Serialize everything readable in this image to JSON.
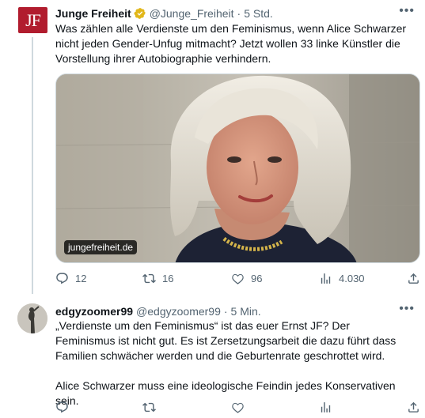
{
  "tweets": [
    {
      "display_name": "Junge Freiheit",
      "avatar_text": "JF",
      "handle": "@Junge_Freiheit",
      "separator": "·",
      "time": "5 Std.",
      "text": [
        "Was zählen alle Verdienste um den Feminismus, wenn Alice Schwarzer nicht jeden Gender-Unfug mitmacht? Jetzt wollen 33 linke Künstler die Vorstellung ihrer Autobiographie verhindern."
      ],
      "media": {
        "source_label": "jungefreiheit.de"
      },
      "actions": {
        "replies": "12",
        "reposts": "16",
        "likes": "96",
        "views": "4.030"
      }
    },
    {
      "display_name": "edgyzoomer99",
      "handle": "@edgyzoomer99",
      "separator": "·",
      "time": "5 Min.",
      "text": [
        "„Verdienste um den Feminismus“ ist das euer Ernst JF? Der Feminismus ist nicht gut. Es ist Zersetzungsarbeit die dazu führt dass Familien schwächer werden und die Geburtenrate geschrottet wird.",
        "Alice Schwarzer muss eine ideologische Feindin jedes Konservativen sein."
      ]
    }
  ],
  "colors": {
    "verified_gold": "#e2b719",
    "jf_red": "#b11c2e",
    "muted": "#536471",
    "line": "#cfd9de"
  },
  "icons": [
    "verified-badge-icon",
    "more-icon",
    "reply-icon",
    "repost-icon",
    "like-icon",
    "views-icon",
    "share-icon"
  ]
}
